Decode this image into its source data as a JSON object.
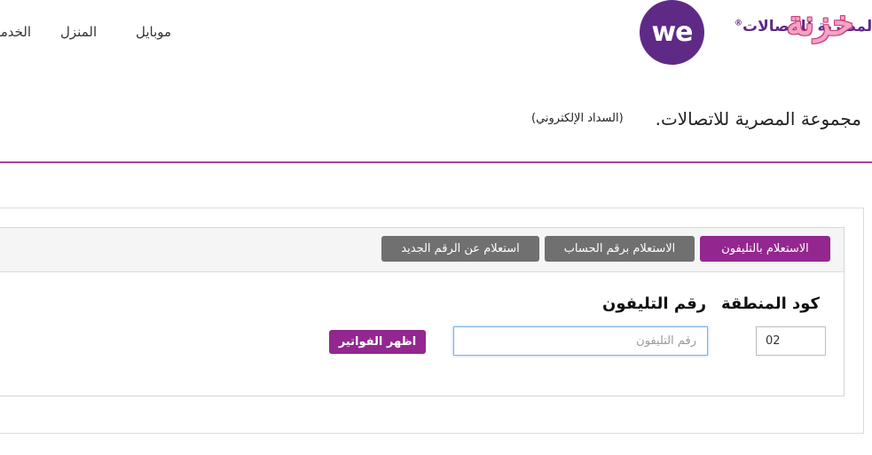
{
  "header": {
    "nav": {
      "mobile": "موبايل",
      "home": "المنزل",
      "services": "الخدمات"
    },
    "brand_text": "المصرية للاتصالات",
    "brand_reg": "®",
    "logo_text": "we",
    "watermark": "خزنة"
  },
  "page": {
    "title": "مجموعة المصرية للاتصالات.",
    "subtitle": "(السداد الإلكتروني)"
  },
  "tabs": [
    {
      "label": "الاستعلام بالتليفون",
      "active": true
    },
    {
      "label": "الاستعلام برقم الحساب",
      "active": false
    },
    {
      "label": "استعلام عن الرقم الجديد",
      "active": false
    }
  ],
  "form": {
    "area_code_label": "كود المنطقة",
    "area_code_value": "02",
    "phone_label": "رقم التليفون",
    "phone_placeholder": "رقم التليفون",
    "submit_label": "اظهر الفواتير"
  },
  "colors": {
    "brand_purple": "#5f2a86",
    "accent": "#93278f",
    "tab_inactive": "#707070",
    "divider": "#a04597"
  }
}
